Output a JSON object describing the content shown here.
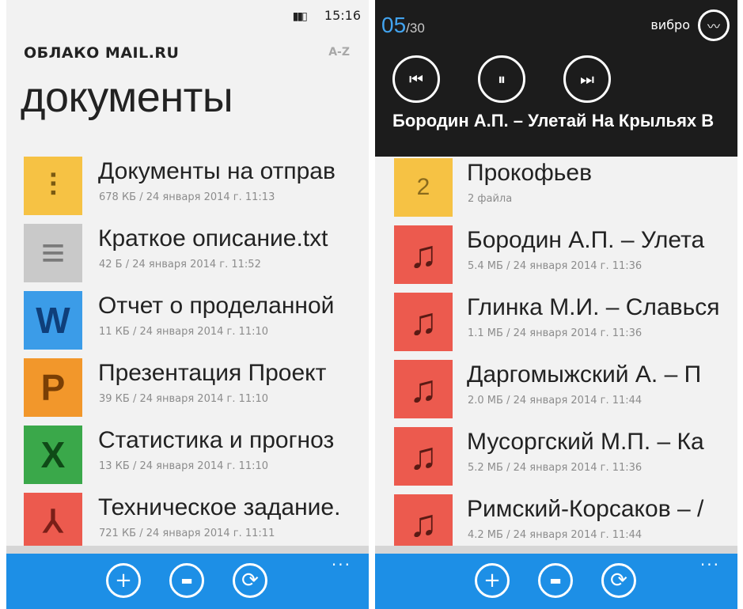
{
  "left": {
    "status": {
      "battery": "▮▮▯",
      "time": "15:16"
    },
    "app_title": "ОБЛАКО MAIL.RU",
    "sort_label": "A-Z",
    "page_title": "документы",
    "files": [
      {
        "name": "Документы на отправ",
        "meta": "678 КБ / 24 января 2014 г. 11:13",
        "icon": "zip-icon",
        "glyph": "⫶",
        "color": "#f6c244"
      },
      {
        "name": "Краткое описание.txt",
        "meta": "42 Б / 24 января 2014 г. 11:52",
        "icon": "text-doc-icon",
        "glyph": "≡",
        "color": "#c9c9c9"
      },
      {
        "name": "Отчет о проделанной",
        "meta": "11 КБ / 24 января 2014 г. 11:10",
        "icon": "word-icon",
        "glyph": "W",
        "color": "#3b9ce8"
      },
      {
        "name": "Презентация  Проект",
        "meta": "39 КБ / 24 января 2014 г. 11:10",
        "icon": "powerpoint-icon",
        "glyph": "P",
        "color": "#f2972b"
      },
      {
        "name": "Статистика и прогноз",
        "meta": "13 КБ / 24 января 2014 г. 11:10",
        "icon": "excel-icon",
        "glyph": "X",
        "color": "#3aa84a"
      },
      {
        "name": "Техническое задание.",
        "meta": "721 КБ / 24 января 2014 г. 11:11",
        "icon": "pdf-icon",
        "glyph": "⅄",
        "color": "#ec5a4e"
      }
    ],
    "more": "···"
  },
  "right": {
    "counter": {
      "current": "05",
      "total": "/30"
    },
    "vibro": "вибро",
    "now_playing": "Бородин А.П.  – Улетай На Крыльях В",
    "files": [
      {
        "name": "Прокофьев",
        "meta": "2 файла",
        "icon": "folder-icon",
        "glyph": "2",
        "color": "#f6c244"
      },
      {
        "name": "Бородин А.П.  – Улета",
        "meta": "5.4 МБ / 24 января 2014 г. 11:36",
        "icon": "music-icon",
        "glyph": "♫",
        "color": "#ec5a4e"
      },
      {
        "name": "Глинка М.И. – Славься",
        "meta": "1.1 МБ / 24 января 2014 г. 11:36",
        "icon": "music-icon",
        "glyph": "♫",
        "color": "#ec5a4e"
      },
      {
        "name": "Даргомыжский А. – П",
        "meta": "2.0 МБ / 24 января 2014 г. 11:44",
        "icon": "music-icon",
        "glyph": "♫",
        "color": "#ec5a4e"
      },
      {
        "name": "Мусоргский М.П. – Ка",
        "meta": "5.2 МБ / 24 января 2014 г. 11:36",
        "icon": "music-icon",
        "glyph": "♫",
        "color": "#ec5a4e"
      },
      {
        "name": "Римский-Корсаков – /",
        "meta": "4.2 МБ / 24 января 2014 г. 11:44",
        "icon": "music-icon",
        "glyph": "♫",
        "color": "#ec5a4e"
      }
    ],
    "more": "···"
  },
  "appbar": {
    "add_glyph": "+",
    "folder_glyph": "▬",
    "sync_glyph": "⟳",
    "accent": "#1d8fe6"
  },
  "player_glyphs": {
    "prev": "⏮",
    "pause": "⏸",
    "next": "⏭",
    "vibro": "〰"
  }
}
